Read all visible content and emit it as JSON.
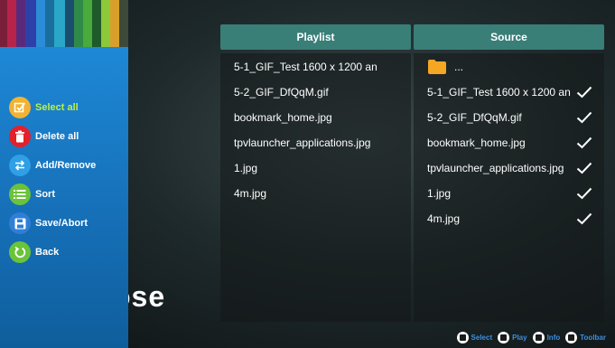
{
  "menu": {
    "items": [
      {
        "label": "Select all",
        "icon": "select-all-icon",
        "color": "#f2b233",
        "selected": true
      },
      {
        "label": "Delete all",
        "icon": "trash-icon",
        "color": "#e4202a"
      },
      {
        "label": "Add/Remove",
        "icon": "swap-icon",
        "color": "#2f9fe6"
      },
      {
        "label": "Sort",
        "icon": "list-icon",
        "color": "#6bc33a"
      },
      {
        "label": "Save/Abort",
        "icon": "save-icon",
        "color": "#2f7fd8"
      },
      {
        "label": "Back",
        "icon": "back-icon",
        "color": "#6bc33a"
      }
    ]
  },
  "background_title": "ose",
  "playlist": {
    "header": "Playlist",
    "items": [
      "5-1_GIF_Test 1600 x 1200 an",
      "5-2_GIF_DfQqM.gif",
      "bookmark_home.jpg",
      "tpvlauncher_applications.jpg",
      "1.jpg",
      "4m.jpg"
    ]
  },
  "source": {
    "header": "Source",
    "parent_folder_label": "...",
    "items": [
      {
        "name": "5-1_GIF_Test 1600 x 1200 an",
        "checked": true
      },
      {
        "name": "5-2_GIF_DfQqM.gif",
        "checked": true
      },
      {
        "name": "bookmark_home.jpg",
        "checked": true
      },
      {
        "name": "tpvlauncher_applications.jpg",
        "checked": true
      },
      {
        "name": "1.jpg",
        "checked": true
      },
      {
        "name": "4m.jpg",
        "checked": true
      }
    ]
  },
  "hints": [
    {
      "label": "Select",
      "icon": "ok-key-icon"
    },
    {
      "label": "Play",
      "icon": "play-key-icon"
    },
    {
      "label": "Info",
      "icon": "info-key-icon"
    },
    {
      "label": "Toolbar",
      "icon": "toolbar-key-icon"
    }
  ],
  "colors": {
    "menu_bg": "#1e88d6",
    "header_bg": "#3a7e78",
    "selected_text": "#b8ef4a",
    "folder": "#f5a623",
    "hint_text": "#3c8fe0"
  }
}
